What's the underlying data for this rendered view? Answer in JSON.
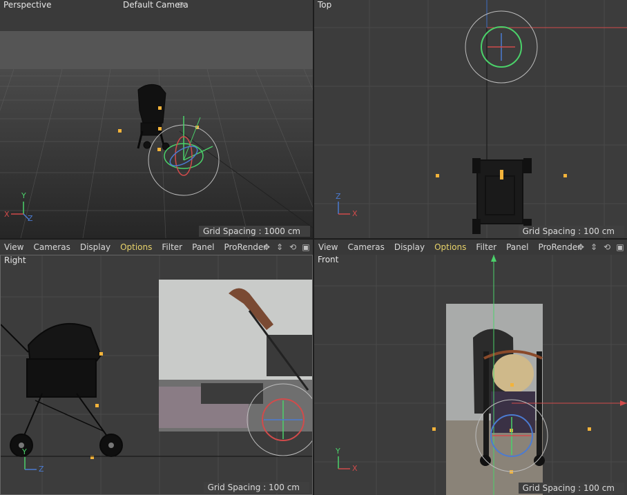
{
  "viewports": {
    "perspective": {
      "name": "Perspective",
      "camera": "Default Camera",
      "grid_spacing": "Grid Spacing : 1000 cm"
    },
    "top": {
      "name": "Top",
      "grid_spacing": "Grid Spacing : 100 cm"
    },
    "right": {
      "name": "Right",
      "grid_spacing": "Grid Spacing : 100 cm"
    },
    "front": {
      "name": "Front",
      "grid_spacing": "Grid Spacing : 100 cm"
    }
  },
  "menu": {
    "view": "View",
    "cameras": "Cameras",
    "display": "Display",
    "options": "Options",
    "filter": "Filter",
    "panel": "Panel",
    "prorender": "ProRender"
  },
  "axes": {
    "x": "X",
    "y": "Y",
    "z": "Z"
  },
  "colors": {
    "accent_options": "#e8d36a",
    "axis_x": "#d24b4b",
    "axis_y": "#4bd26a",
    "axis_z": "#4b7bd2",
    "handle": "#f3b33a"
  },
  "icons": [
    "move-icon",
    "zoom-icon",
    "rotate-icon",
    "maximize-icon"
  ]
}
